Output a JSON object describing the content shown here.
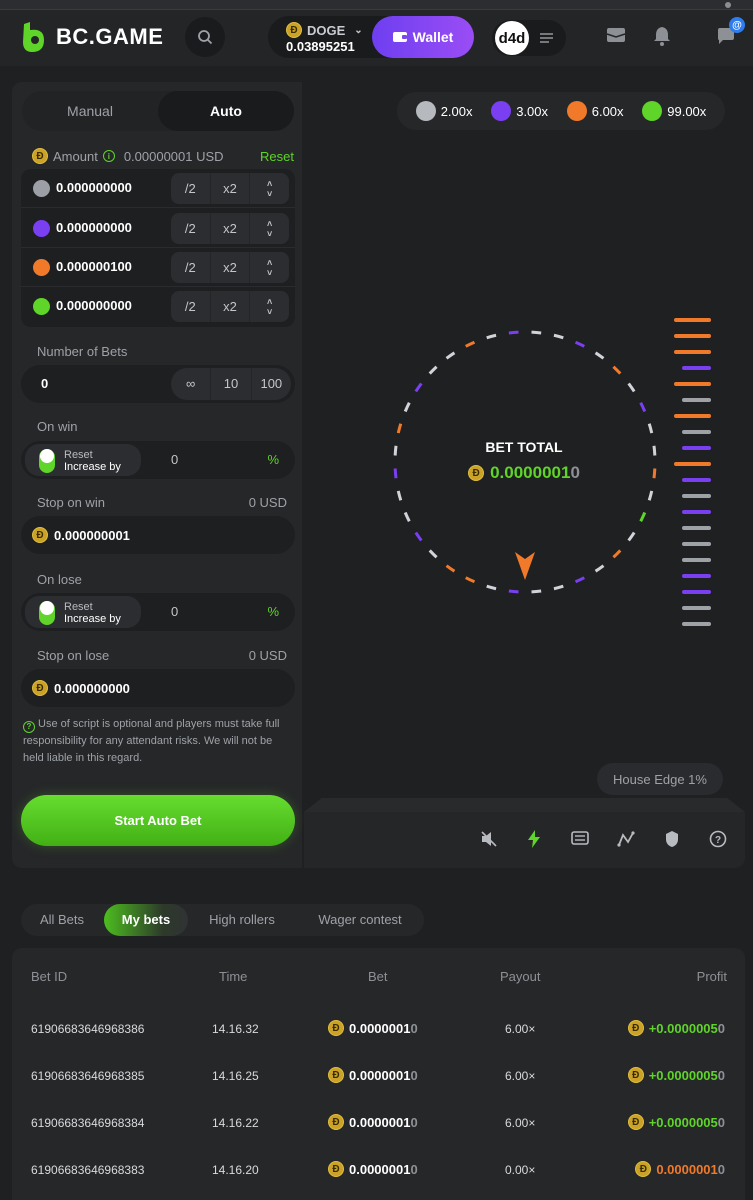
{
  "header": {
    "brand": "BC.GAME",
    "currency": "DOGE",
    "balance": "0.03895251",
    "wallet_label": "Wallet",
    "avatar_text": "d4d",
    "chat_badge": "@"
  },
  "left_panel": {
    "tabs": {
      "manual": "Manual",
      "auto": "Auto"
    },
    "amount_label": "Amount",
    "amount_usd": "0.00000001 USD",
    "reset_label": "Reset",
    "amounts": [
      {
        "value": "0.000000000",
        "color": "#9ca0a6"
      },
      {
        "value": "0.000000000",
        "color": "#7a3ff0"
      },
      {
        "value": "0.000000100",
        "color": "#f07a2a"
      },
      {
        "value": "0.000000000",
        "color": "#5fd429"
      }
    ],
    "half_label": "/2",
    "double_label": "x2",
    "number_of_bets": {
      "label": "Number of Bets",
      "value": "0",
      "opt_inf": "∞",
      "opt_10": "10",
      "opt_100": "100"
    },
    "on_win": {
      "label": "On win",
      "reset": "Reset",
      "increase": "Increase by",
      "value": "0",
      "pct": "%"
    },
    "stop_on_win": {
      "label": "Stop on win",
      "usd": "0 USD",
      "value": "0.000000001"
    },
    "on_lose": {
      "label": "On lose",
      "reset": "Reset",
      "increase": "Increase by",
      "value": "0",
      "pct": "%"
    },
    "stop_on_lose": {
      "label": "Stop on lose",
      "usd": "0 USD",
      "value": "0.000000000"
    },
    "disclaimer": "Use of script is optional and players must take full responsibility for any attendant risks. We will not be held liable in this regard.",
    "start_button": "Start Auto Bet"
  },
  "game": {
    "legend": [
      {
        "label": "2.00x",
        "color": "#b6b9bd"
      },
      {
        "label": "3.00x",
        "color": "#7a3ff0"
      },
      {
        "label": "6.00x",
        "color": "#f07a2a"
      },
      {
        "label": "99.00x",
        "color": "#5fd429"
      }
    ],
    "bet_total_label": "BET TOTAL",
    "bet_total_value": "0.0000001",
    "bet_total_tail": "0",
    "house_edge": "House Edge 1%"
  },
  "bets": {
    "tabs": [
      "All Bets",
      "My bets",
      "High rollers",
      "Wager contest"
    ],
    "active_tab": 1,
    "columns": {
      "id": "Bet ID",
      "time": "Time",
      "bet": "Bet",
      "payout": "Payout",
      "profit": "Profit"
    },
    "rows": [
      {
        "id": "61906683646968386",
        "time": "14.16.32",
        "bet": "0.0000001",
        "bet_tail": "0",
        "payout": "6.00×",
        "profit": "+0.0000005",
        "profit_tail": "0",
        "profit_color": "#5fd429"
      },
      {
        "id": "61906683646968385",
        "time": "14.16.25",
        "bet": "0.0000001",
        "bet_tail": "0",
        "payout": "6.00×",
        "profit": "+0.0000005",
        "profit_tail": "0",
        "profit_color": "#5fd429"
      },
      {
        "id": "61906683646968384",
        "time": "14.16.22",
        "bet": "0.0000001",
        "bet_tail": "0",
        "payout": "6.00×",
        "profit": "+0.0000005",
        "profit_tail": "0",
        "profit_color": "#5fd429"
      },
      {
        "id": "61906683646968383",
        "time": "14.16.20",
        "bet": "0.0000001",
        "bet_tail": "0",
        "payout": "0.00×",
        "profit": "0.0000001",
        "profit_tail": "0",
        "profit_color": "#f07a2a"
      }
    ]
  },
  "colors": {
    "accent_green": "#5fd429",
    "purple": "#7a3ff0",
    "orange": "#f07a2a",
    "grey": "#b6b9bd"
  }
}
